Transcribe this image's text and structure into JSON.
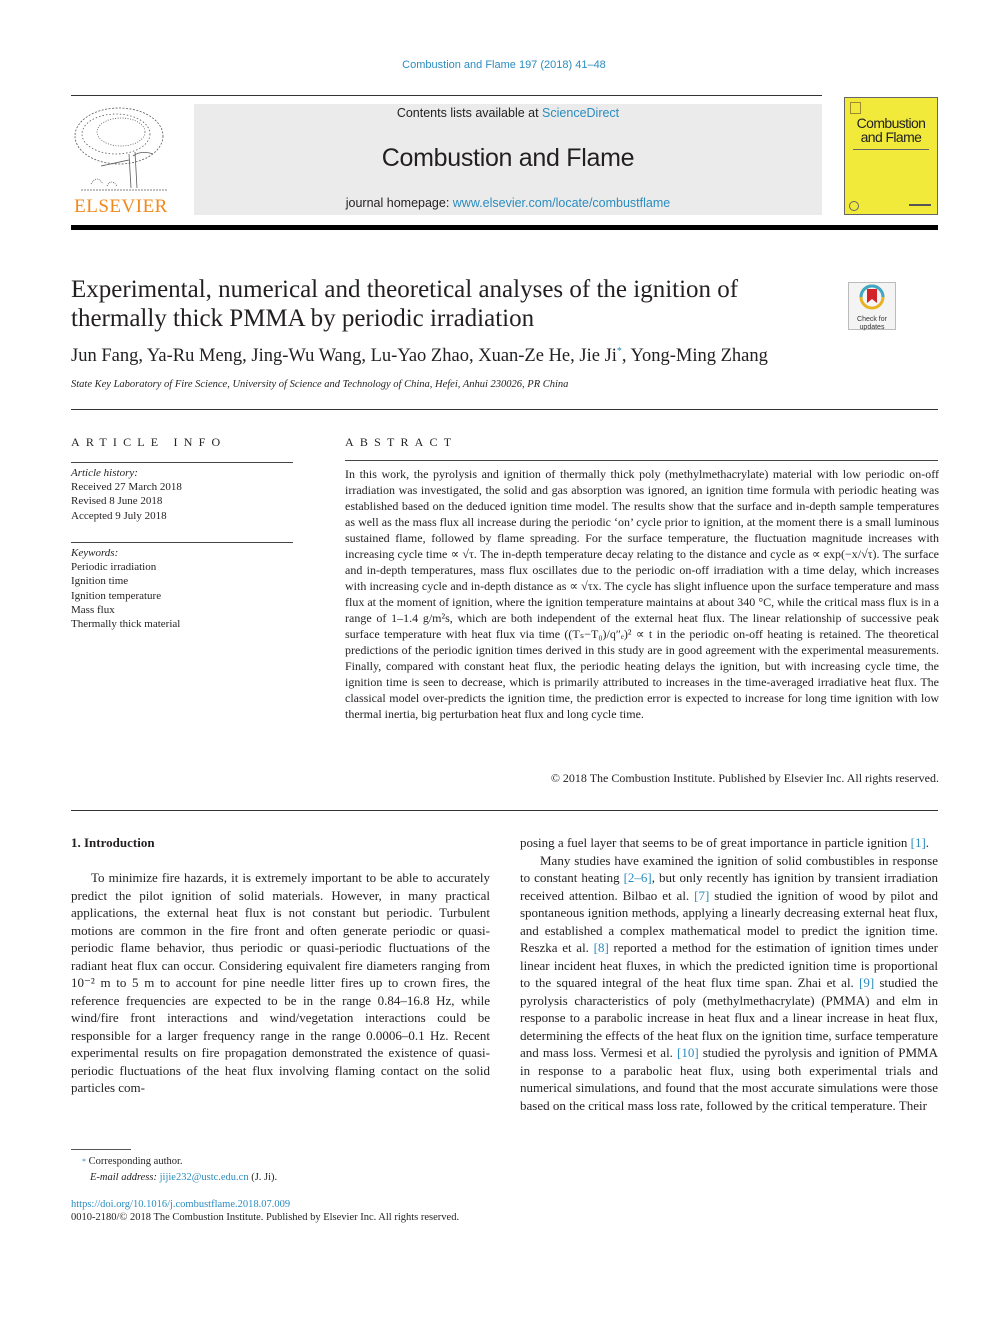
{
  "header": {
    "journal_ref": "Combustion and Flame 197 (2018) 41–48",
    "contents_prefix": "Contents lists available at ",
    "contents_link": "ScienceDirect",
    "journal_title": "Combustion and Flame",
    "homepage_prefix": "journal homepage: ",
    "homepage_link": "www.elsevier.com/locate/combustflame",
    "publisher_logo_text": "ELSEVIER",
    "cover_title_line1": "Combustion",
    "cover_title_line2": "and Flame",
    "colors": {
      "link": "#2a8cbf",
      "publisher": "#f08a1c",
      "cover": "#f2ea3a"
    }
  },
  "article": {
    "title": "Experimental, numerical and theoretical analyses of the ignition of thermally thick PMMA by periodic irradiation",
    "crossmark_label": "Check for updates",
    "authors": [
      {
        "name": "Jun Fang",
        "mark": ""
      },
      {
        "name": "Ya-Ru Meng",
        "mark": ""
      },
      {
        "name": "Jing-Wu Wang",
        "mark": ""
      },
      {
        "name": "Lu-Yao Zhao",
        "mark": ""
      },
      {
        "name": "Xuan-Ze He",
        "mark": ""
      },
      {
        "name": "Jie Ji",
        "mark": "*"
      },
      {
        "name": "Yong-Ming Zhang",
        "mark": ""
      }
    ],
    "affiliation": "State Key Laboratory of Fire Science, University of Science and Technology of China, Hefei, Anhui 230026, PR China"
  },
  "article_info": {
    "heading": "ARTICLE INFO",
    "history_label": "Article history:",
    "history": [
      "Received 27 March 2018",
      "Revised 8 June 2018",
      "Accepted 9 July 2018"
    ],
    "keywords_label": "Keywords:",
    "keywords": [
      "Periodic irradiation",
      "Ignition time",
      "Ignition temperature",
      "Mass flux",
      "Thermally thick material"
    ]
  },
  "abstract": {
    "heading": "ABSTRACT",
    "text": "In this work, the pyrolysis and ignition of thermally thick poly (methylmethacrylate) material with low periodic on-off irradiation was investigated, the solid and gas absorption was ignored, an ignition time formula with periodic heating was established based on the deduced ignition time model. The results show that the surface and in-depth sample temperatures as well as the mass flux all increase during the periodic ‘on’ cycle prior to ignition, at the moment there is a small luminous sustained flame, followed by flame spreading. For the surface temperature, the fluctuation magnitude increases with increasing cycle time ∝ √τ. The in-depth temperature decay relating to the distance and cycle as ∝ exp(−x/√τ). The surface and in-depth temperatures, mass flux oscillates due to the periodic on-off irradiation with a time delay, which increases with increasing cycle and in-depth distance as ∝ √τx. The cycle has slight influence upon the surface temperature and mass flux at the moment of ignition, where the ignition temperature maintains at about 340 °C, while the critical mass flux is in a range of 1–1.4 g/m²s, which are both independent of the external heat flux. The linear relationship of successive peak surface temperature with heat flux via time ((Tₛ−T₀)/q″ₑ)² ∝ t in the periodic on-off heating is retained. The theoretical predictions of the periodic ignition times derived in this study are in good agreement with the experimental measurements. Finally, compared with constant heat flux, the periodic heating delays the ignition, but with increasing cycle time, the ignition time is seen to decrease, which is primarily attributed to increases in the time-averaged irradiative heat flux. The classical model over-predicts the ignition time, the prediction error is expected to increase for long time ignition with low thermal inertia, big perturbation heat flux and long cycle time.",
    "copyright": "© 2018 The Combustion Institute. Published by Elsevier Inc. All rights reserved."
  },
  "body": {
    "section_heading": "1. Introduction",
    "left_paragraph": "To minimize fire hazards, it is extremely important to be able to accurately predict the pilot ignition of solid materials. However, in many practical applications, the external heat flux is not constant but periodic. Turbulent motions are common in the fire front and often generate periodic or quasi-periodic flame behavior, thus periodic or quasi-periodic fluctuations of the radiant heat flux can occur. Considering equivalent fire diameters ranging from 10⁻² m to 5 m to account for pine needle litter fires up to crown fires, the reference frequencies are expected to be in the range 0.84–16.8 Hz, while wind/fire front interactions and wind/vegetation interactions could be responsible for a larger frequency range in the range 0.0006–0.1 Hz. Recent experimental results on fire propagation demonstrated the existence of quasi-periodic fluctuations of the heat flux involving flaming contact on the solid particles com-",
    "right_p1_text": "posing a fuel layer that seems to be of great importance in particle ignition ",
    "right_p1_cite": "[1]",
    "right_p2": [
      {
        "t": "Many studies have examined the ignition of solid combustibles in response to constant heating ",
        "c": ""
      },
      {
        "t": "",
        "c": "[2–6]"
      },
      {
        "t": ", but only recently has ignition by transient irradiation received attention. Bilbao et al. ",
        "c": ""
      },
      {
        "t": "",
        "c": "[7]"
      },
      {
        "t": " studied the ignition of wood by pilot and spontaneous ignition methods, applying a linearly decreasing external heat flux, and established a complex mathematical model to predict the ignition time. Reszka et al. ",
        "c": ""
      },
      {
        "t": "",
        "c": "[8]"
      },
      {
        "t": " reported a method for the estimation of ignition times under linear incident heat fluxes, in which the predicted ignition time is proportional to the squared integral of the heat flux time span. Zhai et al. ",
        "c": ""
      },
      {
        "t": "",
        "c": "[9]"
      },
      {
        "t": " studied the pyrolysis characteristics of poly (methylmethacrylate) (PMMA) and elm in response to a parabolic increase in heat flux and a linear increase in heat flux, determining the effects of the heat flux on the ignition time, surface temperature and mass loss. Vermesi et al. ",
        "c": ""
      },
      {
        "t": "",
        "c": "[10]"
      },
      {
        "t": " studied the pyrolysis and ignition of PMMA in response to a parabolic heat flux, using both experimental trials and numerical simulations, and found that the most accurate simulations were those based on the critical mass loss rate, followed by the critical temperature. Their",
        "c": ""
      }
    ]
  },
  "footnote": {
    "mark": "*",
    "corresponding": "Corresponding author.",
    "email_label": "E-mail address:",
    "email": "jijie232@ustc.edu.cn",
    "email_suffix": " (J. Ji).",
    "doi": "https://doi.org/10.1016/j.combustflame.2018.07.009",
    "issn_line": "0010-2180/© 2018 The Combustion Institute. Published by Elsevier Inc. All rights reserved."
  }
}
